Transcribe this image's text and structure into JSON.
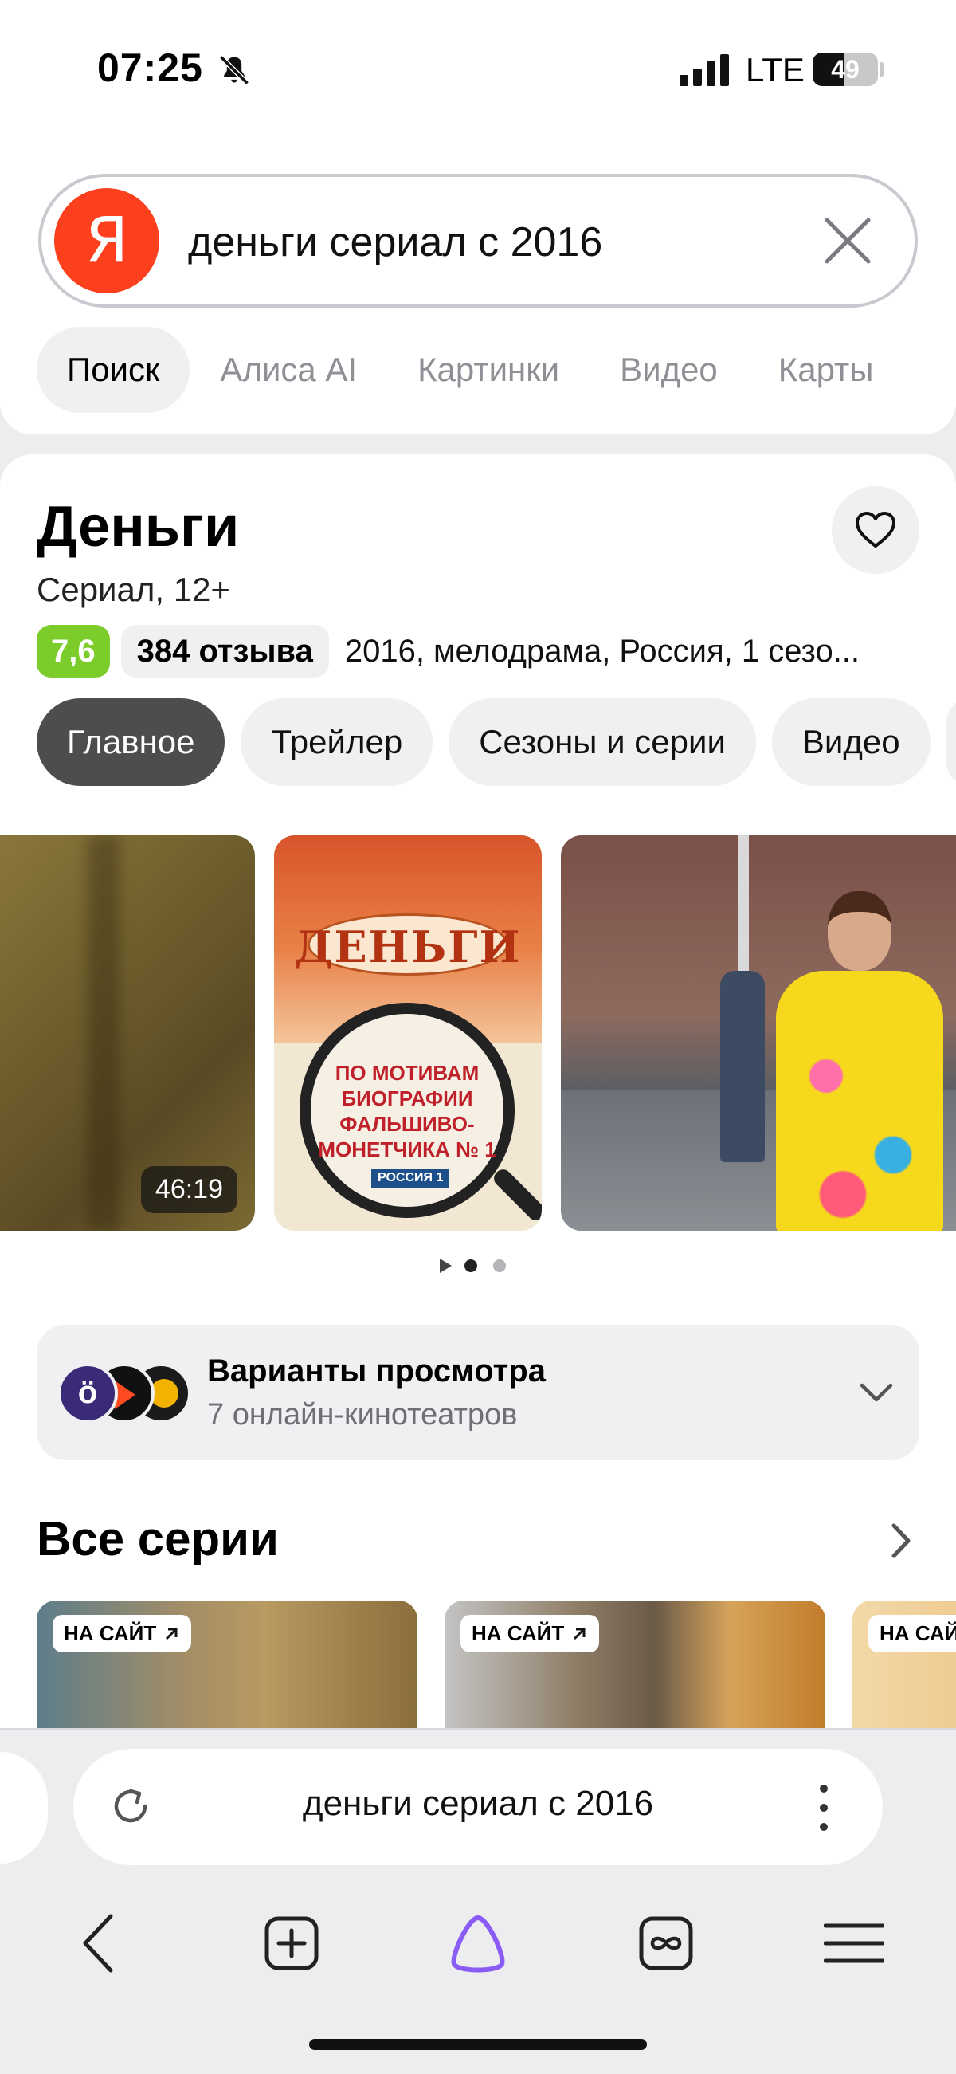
{
  "status": {
    "time": "07:25",
    "network": "LTE",
    "battery": "49",
    "battery_level": 0.49
  },
  "search": {
    "logo_letter": "Я",
    "query": "деньги сериал с 2016"
  },
  "search_tabs": [
    {
      "label": "Поиск",
      "active": true
    },
    {
      "label": "Алиса AI"
    },
    {
      "label": "Картинки"
    },
    {
      "label": "Видео"
    },
    {
      "label": "Карты"
    }
  ],
  "card": {
    "title": "Деньги",
    "subtitle": "Сериал, 12+",
    "rating": "7,6",
    "reviews": "384 отзыва",
    "info": "2016, мелодрама, Россия, 1 сезо...",
    "pills": [
      {
        "label": "Главное",
        "active": true
      },
      {
        "label": "Трейлер"
      },
      {
        "label": "Сезоны и серии"
      },
      {
        "label": "Видео"
      }
    ],
    "gallery": {
      "duration": "46:19",
      "poster_title": "ДЕНЬГИ",
      "poster_text": "ПО МОТИВАМ БИОГРАФИИ ФАЛЬШИВО-МОНЕТЧИКА № 1",
      "poster_badge": "РОССИЯ 1",
      "pages": 2,
      "active_page": 1
    },
    "watch": {
      "title": "Варианты просмотра",
      "subtitle": "7 онлайн-кинотеатров",
      "provider_1_letter": "ö"
    },
    "episodes": {
      "title": "Все серии",
      "badge": "НА САЙТ",
      "badge_cut": "НА САЙ"
    }
  },
  "browser": {
    "address": "деньги сериал с 2016",
    "accent_color": "#8a5cf5"
  },
  "colors": {
    "yandex_red": "#fc3f1d",
    "rating_green": "#7ccd2c"
  }
}
